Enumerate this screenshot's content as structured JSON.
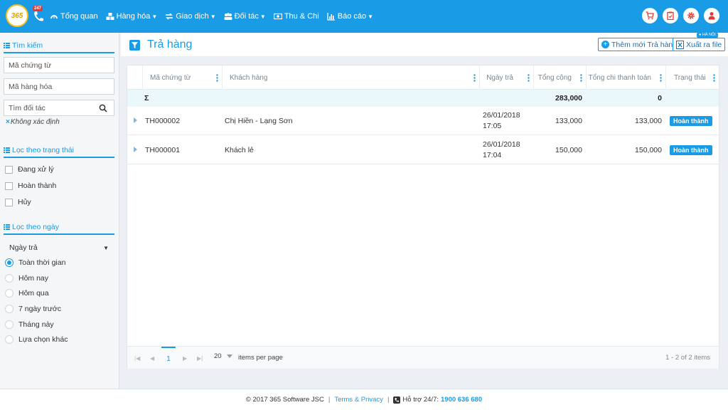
{
  "app": {
    "logo_text": "365",
    "hotline_badge": "247"
  },
  "nav": [
    {
      "label": "Tổng quan",
      "icon": "dashboard-icon",
      "dropdown": false
    },
    {
      "label": "Hàng hóa",
      "icon": "cubes-icon",
      "dropdown": true
    },
    {
      "label": "Giao dịch",
      "icon": "exchange-icon",
      "dropdown": true
    },
    {
      "label": "Đối tác",
      "icon": "users-icon",
      "dropdown": true
    },
    {
      "label": "Thu & Chi",
      "icon": "money-icon",
      "dropdown": false
    },
    {
      "label": "Báo cáo",
      "icon": "bar-chart-icon",
      "dropdown": true
    }
  ],
  "sidebar": {
    "search_title": "Tìm kiếm",
    "voucher_placeholder": "Mã chứng từ",
    "product_placeholder": "Mã hàng hóa",
    "partner_placeholder": "Tìm đối tác",
    "partner_tag": "Không xác định",
    "status_title": "Lọc theo trạng thái",
    "statuses": [
      "Đang xử lý",
      "Hoàn thành",
      "Hủy"
    ],
    "date_title": "Lọc theo ngày",
    "date_select": "Ngày trả",
    "date_options": [
      "Toàn thời gian",
      "Hôm nay",
      "Hôm qua",
      "7 ngày trước",
      "Tháng này",
      "Lựa chọn khác"
    ]
  },
  "header": {
    "title": "Trả hàng",
    "add_label": "Thêm mới Trả hàng",
    "export_label": "Xuất ra file",
    "location_badge": "HÀ NỘI"
  },
  "table": {
    "columns": [
      "Mã chứng từ",
      "Khách hàng",
      "Ngày trả",
      "Tổng cộng",
      "Tổng chi thanh toán",
      "Trạng thái"
    ],
    "sum": {
      "symbol": "Σ",
      "total": "283,000",
      "paid": "0"
    },
    "rows": [
      {
        "code": "TH000002",
        "customer": "Chị Hiền - Lạng Sơn",
        "date": "26/01/2018",
        "time": "17:05",
        "total": "133,000",
        "paid": "133,000",
        "status": "Hoàn thành"
      },
      {
        "code": "TH000001",
        "customer": "Khách lẻ",
        "date": "26/01/2018",
        "time": "17:04",
        "total": "150,000",
        "paid": "150,000",
        "status": "Hoàn thành"
      }
    ]
  },
  "pager": {
    "current": "1",
    "page_size": "20",
    "page_size_label": "items per page",
    "info": "1 - 2 of 2 items"
  },
  "footer": {
    "copyright": "© 2017 365 Software JSC",
    "sep": "|",
    "terms": "Terms & Privacy",
    "support": "Hỗ trợ 24/7:",
    "phone": "1900 636 680"
  },
  "colors": {
    "primary": "#1a9be6",
    "sum_row": "#eaf8fc"
  }
}
